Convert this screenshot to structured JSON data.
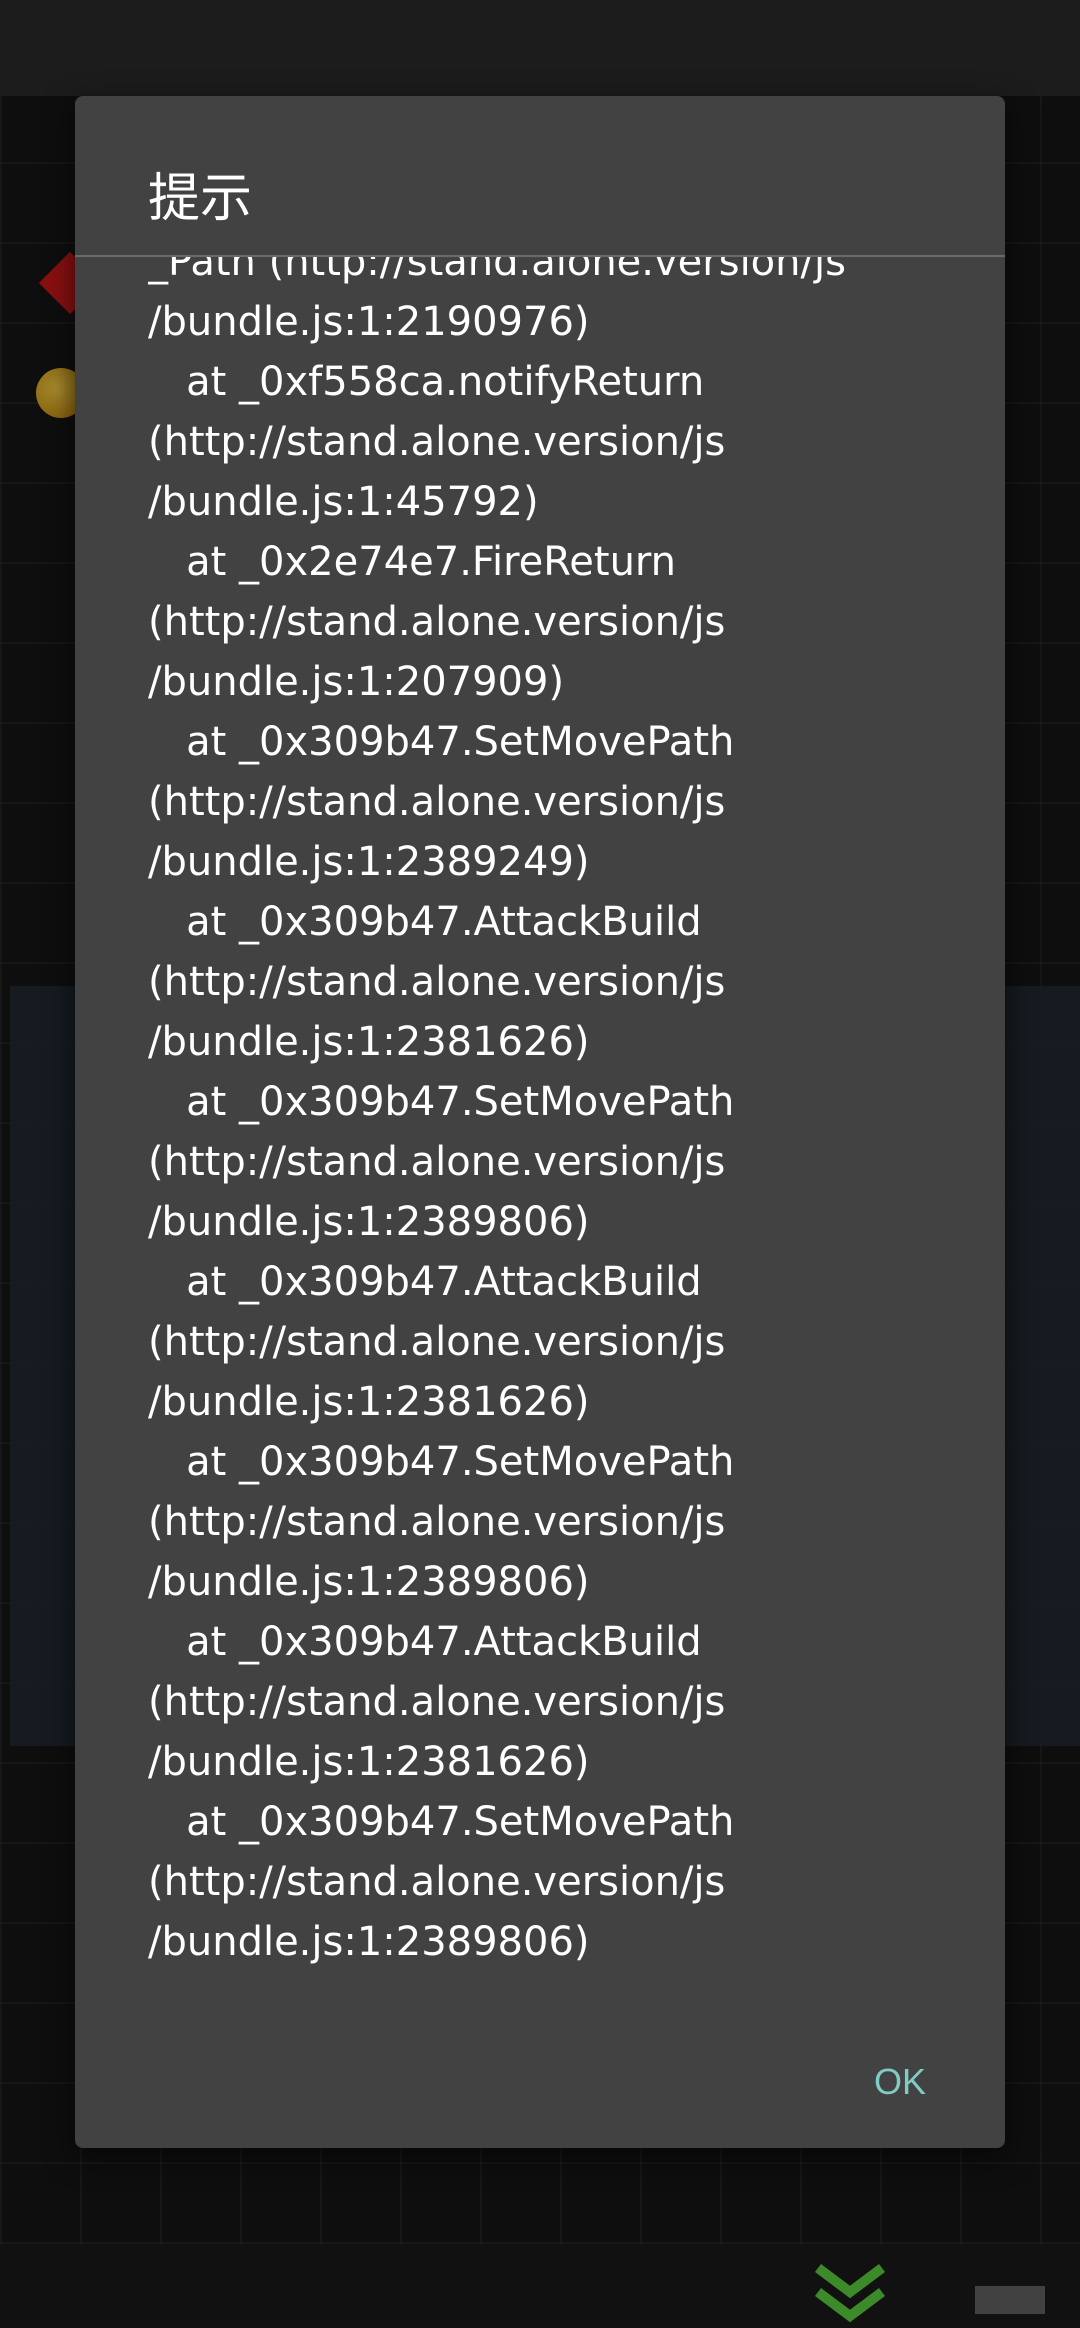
{
  "dialog": {
    "title": "提示",
    "message_lines": [
      "_Path (http://stand.alone.version/js",
      "/bundle.js:1:2190976)",
      "   at _0xf558ca.notifyReturn",
      "(http://stand.alone.version/js",
      "/bundle.js:1:45792)",
      "   at _0x2e74e7.FireReturn",
      "(http://stand.alone.version/js",
      "/bundle.js:1:207909)",
      "   at _0x309b47.SetMovePath",
      "(http://stand.alone.version/js",
      "/bundle.js:1:2389249)",
      "   at _0x309b47.AttackBuild",
      "(http://stand.alone.version/js",
      "/bundle.js:1:2381626)",
      "   at _0x309b47.SetMovePath",
      "(http://stand.alone.version/js",
      "/bundle.js:1:2389806)",
      "   at _0x309b47.AttackBuild",
      "(http://stand.alone.version/js",
      "/bundle.js:1:2381626)",
      "   at _0x309b47.SetMovePath",
      "(http://stand.alone.version/js",
      "/bundle.js:1:2389806)",
      "   at _0x309b47.AttackBuild",
      "(http://stand.alone.version/js",
      "/bundle.js:1:2381626)",
      "   at _0x309b47.SetMovePath",
      "(http://stand.alone.version/js",
      "/bundle.js:1:2389806)"
    ],
    "ok_label": "OK"
  },
  "colors": {
    "dialog_bg": "#424242",
    "accent": "#80cbc4",
    "text": "#ffffff"
  }
}
